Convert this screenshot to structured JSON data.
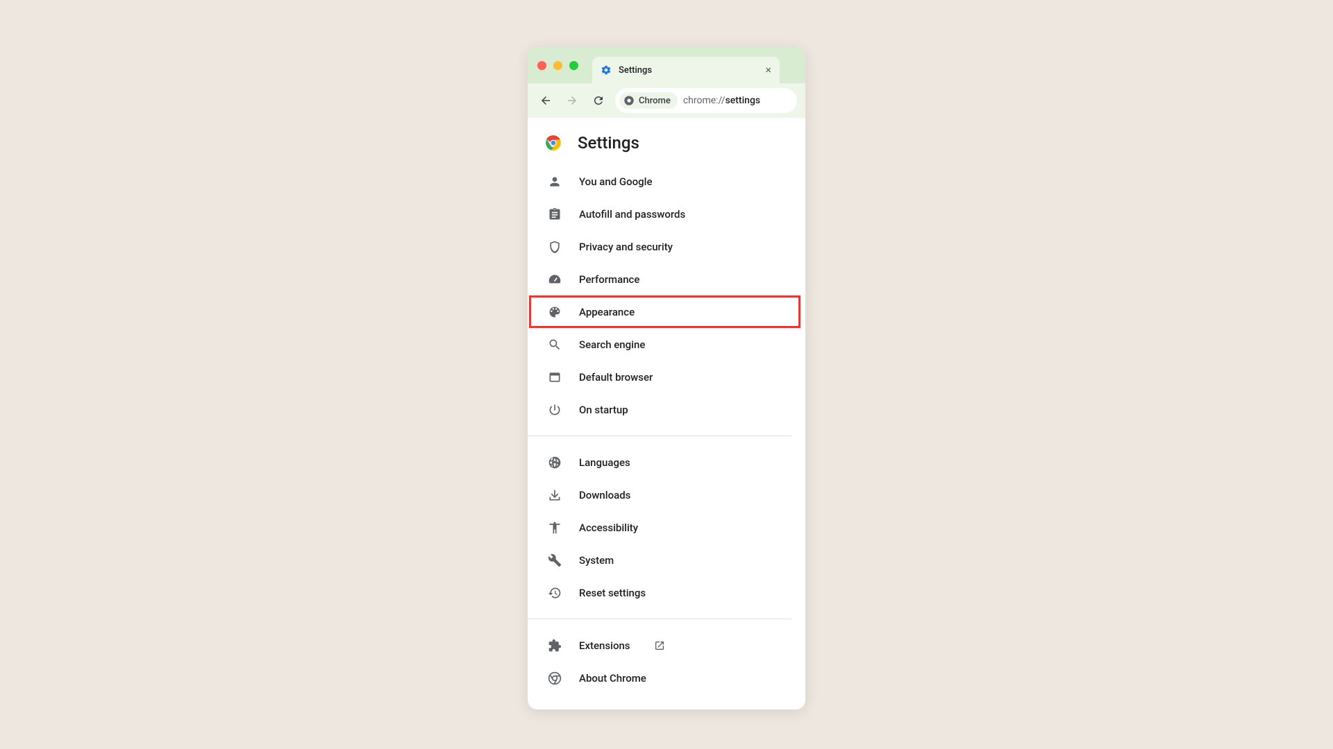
{
  "window": {
    "tab_title": "Settings",
    "tab_close": "×"
  },
  "address": {
    "chip_label": "Chrome",
    "url_prefix": "chrome://",
    "url_path": "settings"
  },
  "page": {
    "title": "Settings"
  },
  "nav": {
    "group1": [
      {
        "key": "you-and-google",
        "label": "You and Google",
        "icon": "person"
      },
      {
        "key": "autofill",
        "label": "Autofill and passwords",
        "icon": "clipboard"
      },
      {
        "key": "privacy",
        "label": "Privacy and security",
        "icon": "shield"
      },
      {
        "key": "performance",
        "label": "Performance",
        "icon": "speedometer"
      },
      {
        "key": "appearance",
        "label": "Appearance",
        "icon": "palette",
        "highlighted": true
      },
      {
        "key": "search-engine",
        "label": "Search engine",
        "icon": "search"
      },
      {
        "key": "default-browser",
        "label": "Default browser",
        "icon": "window"
      },
      {
        "key": "on-startup",
        "label": "On startup",
        "icon": "power"
      }
    ],
    "group2": [
      {
        "key": "languages",
        "label": "Languages",
        "icon": "globe"
      },
      {
        "key": "downloads",
        "label": "Downloads",
        "icon": "download"
      },
      {
        "key": "accessibility",
        "label": "Accessibility",
        "icon": "accessibility"
      },
      {
        "key": "system",
        "label": "System",
        "icon": "wrench"
      },
      {
        "key": "reset",
        "label": "Reset settings",
        "icon": "history"
      }
    ],
    "group3": [
      {
        "key": "extensions",
        "label": "Extensions",
        "icon": "extension",
        "external": true
      },
      {
        "key": "about",
        "label": "About Chrome",
        "icon": "chrome"
      }
    ]
  }
}
